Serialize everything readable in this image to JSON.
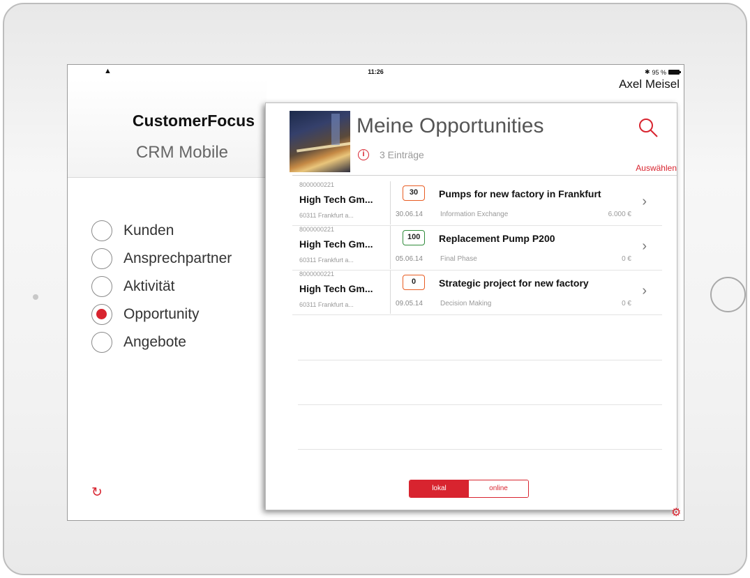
{
  "statusbar": {
    "time": "11:26",
    "battery_text": "95 %"
  },
  "user": {
    "name": "Axel Meisel"
  },
  "brand": {
    "title": "CustomerFocus",
    "subtitle": "CRM Mobile"
  },
  "nav": {
    "items": [
      {
        "label": "Kunden",
        "selected": false
      },
      {
        "label": "Ansprechpartner",
        "selected": false
      },
      {
        "label": "Aktivität",
        "selected": false
      },
      {
        "label": "Opportunity",
        "selected": true
      },
      {
        "label": "Angebote",
        "selected": false
      }
    ]
  },
  "panel": {
    "title": "Meine Opportunities",
    "count": "3 Einträge",
    "select_label": "Auswählen",
    "rows": [
      {
        "number": "8000000221",
        "customer": "High Tech Gm...",
        "city": "60311 Frankfurt a...",
        "badge": "30",
        "badge_color": "orange",
        "title": "Pumps for new factory in Frankfurt",
        "date": "30.06.14",
        "phase": "Information Exchange",
        "amount": "6.000 €"
      },
      {
        "number": "8000000221",
        "customer": "High Tech Gm...",
        "city": "60311 Frankfurt a...",
        "badge": "100",
        "badge_color": "green",
        "title": "Replacement Pump P200",
        "date": "05.06.14",
        "phase": "Final Phase",
        "amount": "0 €"
      },
      {
        "number": "8000000221",
        "customer": "High Tech Gm...",
        "city": "60311 Frankfurt a...",
        "badge": "0",
        "badge_color": "orange",
        "title": "Strategic project for new factory",
        "date": "09.05.14",
        "phase": "Decision Making",
        "amount": "0 €"
      }
    ],
    "segment": {
      "local": "lokal",
      "online": "online",
      "active": "lokal"
    }
  },
  "colors": {
    "accent": "#d8242f",
    "badge_orange": "#e85c22",
    "badge_green": "#2f8a3a"
  },
  "icons": [
    "wifi-icon",
    "battery-icon",
    "bluetooth-icon",
    "info-icon",
    "search-icon",
    "chevron-right-icon",
    "refresh-icon",
    "settings-icon",
    "radio-button"
  ]
}
